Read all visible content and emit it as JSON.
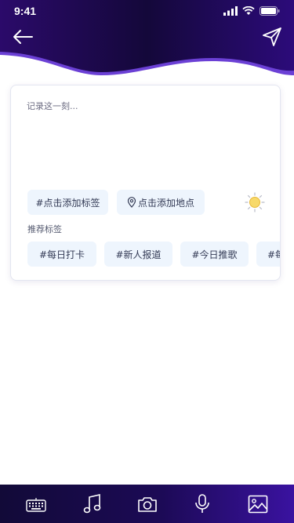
{
  "status_bar": {
    "time": "9:41"
  },
  "header": {
    "back_icon": "back-arrow-icon",
    "send_icon": "send-icon"
  },
  "editor": {
    "placeholder": "记录这一刻...",
    "add_tag_label": "#点击添加标签",
    "add_location_label": "点击添加地点",
    "weather_icon": "sun-icon"
  },
  "recommended": {
    "title": "推荐标签",
    "tags": [
      "#每日打卡",
      "#新人报道",
      "#今日推歌",
      "#每"
    ]
  },
  "toolbar": {
    "items": [
      "keyboard-icon",
      "music-icon",
      "camera-icon",
      "microphone-icon",
      "image-icon"
    ]
  },
  "colors": {
    "header_dark": "#15093f",
    "header_purple": "#3c0fa0",
    "chip_bg": "#eef5fd"
  }
}
